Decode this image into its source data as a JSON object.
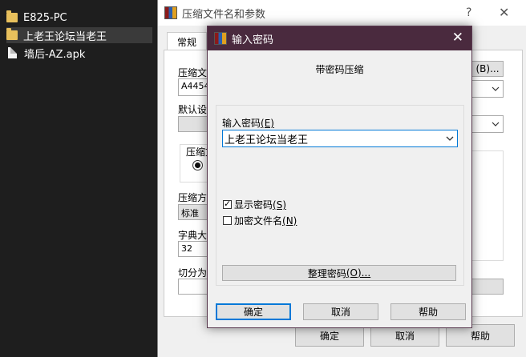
{
  "desktop": {
    "items": [
      {
        "label": "E825-PC",
        "icon": "folder-icon"
      },
      {
        "label": "上老王论坛当老王",
        "icon": "folder-icon"
      },
      {
        "label": "墙后-AZ.apk",
        "icon": "file-icon"
      }
    ]
  },
  "main_dialog": {
    "title": "压缩文件名和参数",
    "help_glyph": "?",
    "close_glyph": "✕",
    "tab_general": "常规",
    "archive_name_label": "压缩文",
    "archive_name_value": "A4454",
    "browse_button": "(B)...",
    "default_profile_label": "默认设",
    "format_label": "压缩文",
    "method_label": "压缩方",
    "method_value": "标准",
    "dict_label": "字典大",
    "dict_value": "32",
    "split_label": "切分为",
    "ok": "确定",
    "cancel": "取消",
    "help": "帮助"
  },
  "password_dialog": {
    "title": "输入密码",
    "close_glyph": "✕",
    "heading": "带密码压缩",
    "password_label": "输入密码",
    "password_label_key": "(E)",
    "password_value": "上老王论坛当老王",
    "show_password": "显示密码",
    "show_password_key": "(S)",
    "show_password_checked": true,
    "encrypt_filenames": "加密文件名",
    "encrypt_filenames_key": "(N)",
    "encrypt_filenames_checked": false,
    "organize_button": "整理密码",
    "organize_button_key": "(O)...",
    "ok": "确定",
    "cancel": "取消",
    "help": "帮助"
  },
  "colors": {
    "pw_titlebar": "#4a2a3e",
    "focus_blue": "#0078d7",
    "desktop_bg": "#1e1e1e"
  }
}
